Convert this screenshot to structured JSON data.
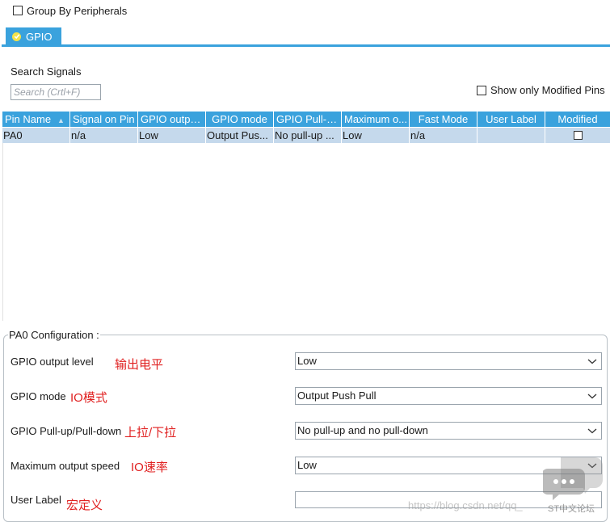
{
  "group_by_peripherals": {
    "label": "Group By Peripherals",
    "checked": false
  },
  "tab": {
    "label": "GPIO"
  },
  "search": {
    "label": "Search Signals",
    "placeholder": "Search (Crtl+F)"
  },
  "show_modified": {
    "label": "Show only Modified Pins",
    "checked": false
  },
  "table": {
    "columns": [
      "Pin Name",
      "Signal on Pin",
      "GPIO output...",
      "GPIO mode",
      "GPIO Pull-u...",
      "Maximum o...",
      "Fast Mode",
      "User Label",
      "Modified"
    ],
    "rows": [
      {
        "pin": "PA0",
        "signal": "n/a",
        "output_level": "Low",
        "mode": "Output Pus...",
        "pull": "No pull-up ...",
        "max_speed": "Low",
        "fast_mode": "n/a",
        "user_label": "",
        "modified": false
      }
    ]
  },
  "config": {
    "title": "PA0 Configuration :",
    "fields": [
      {
        "label": "GPIO output level",
        "note": "输出电平",
        "value": "Low"
      },
      {
        "label": "GPIO mode",
        "note": "IO模式",
        "value": "Output Push Pull"
      },
      {
        "label": "GPIO Pull-up/Pull-down",
        "note": "上拉/下拉",
        "value": "No pull-up and no pull-down"
      },
      {
        "label": "Maximum output speed",
        "note": "IO速率",
        "value": "Low"
      },
      {
        "label": "User Label",
        "note": "宏定义",
        "value": ""
      }
    ]
  },
  "watermark": {
    "url": "https://blog.csdn.net/qq_",
    "brand": "ST中文论坛"
  },
  "colors": {
    "accent": "#3aa2dd",
    "row_selected": "#c5d9ec",
    "note_red": "#e02020"
  }
}
